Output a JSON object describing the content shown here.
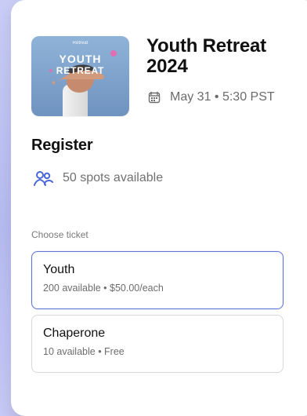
{
  "event": {
    "title": "Youth Retreat 2024",
    "date_time": "May 31 • 5:30 PST",
    "image_text": {
      "top": "Retreat",
      "line1": "YOUTH",
      "line2": "RETREAT"
    }
  },
  "register": {
    "title": "Register",
    "spots_available": "50 spots available",
    "choose_ticket_label": "Choose ticket",
    "tickets": [
      {
        "name": "Youth",
        "details": "200 available • $50.00/each",
        "selected": true
      },
      {
        "name": "Chaperone",
        "details": "10 available • Free",
        "selected": false
      }
    ]
  },
  "colors": {
    "accent_blue": "#5c74d8",
    "icon_blue": "#4b67d7",
    "muted_text": "#6b6b6b",
    "border": "#d7d7d7"
  }
}
